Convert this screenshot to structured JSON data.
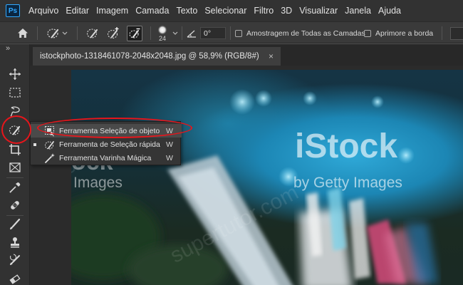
{
  "menubar": {
    "logo": "Ps",
    "items": [
      "Arquivo",
      "Editar",
      "Imagem",
      "Camada",
      "Texto",
      "Selecionar",
      "Filtro",
      "3D",
      "Visualizar",
      "Janela",
      "Ajuda"
    ]
  },
  "options": {
    "brush_size": "24",
    "angle": "0°",
    "sample_all_layers": "Amostragem de Todas as Camadas",
    "enhance_edge": "Aprimore a borda"
  },
  "toolbar": {
    "collapse": "»"
  },
  "document": {
    "tab_title": "istockphoto-1318461078-2048x2048.jpg @ 58,9% (RGB/8#)",
    "close": "×"
  },
  "flyout": {
    "items": [
      {
        "label": "Ferramenta Seleção de objeto",
        "shortcut": "W"
      },
      {
        "label": "Ferramenta de Seleção rápida",
        "shortcut": "W"
      },
      {
        "label": "Ferramenta Varinha Mágica",
        "shortcut": "W"
      }
    ]
  },
  "watermark": {
    "istock": "iStock",
    "getty": "by Getty Images",
    "images_left": "Images",
    "partial_left": "ock",
    "site": "supertutor.com"
  },
  "colors": {
    "highlight_red": "#e8151b",
    "ps_blue": "#31a8ff",
    "panel_dark": "#323232"
  }
}
